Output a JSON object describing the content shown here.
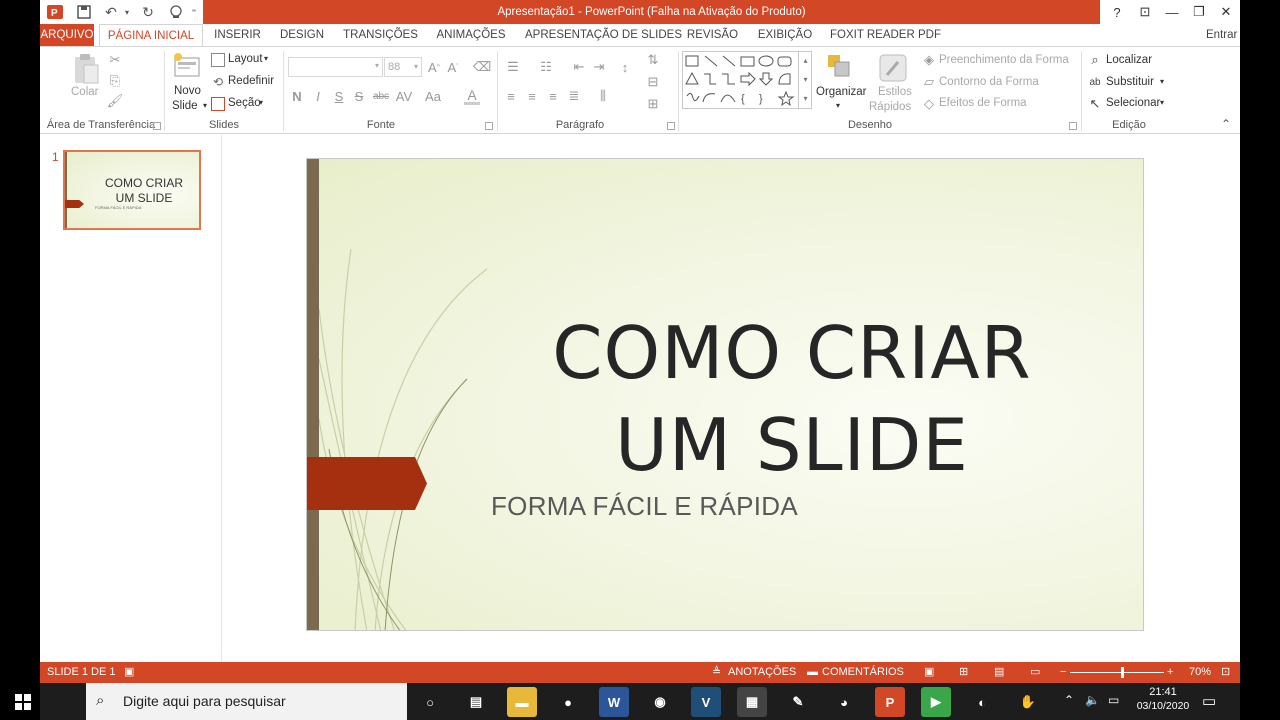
{
  "app": {
    "window_title": "Apresentação1 -  PowerPoint (Falha na Ativação do Produto)",
    "brand_color": "#d24726",
    "window_controls": {
      "help": "?",
      "ribbon_options": "⊡",
      "minimize": "—",
      "restore": "❐",
      "close": "✕"
    }
  },
  "quick_access": {
    "icons": [
      "powerpoint-logo-icon",
      "save-icon",
      "undo-icon",
      "redo-icon",
      "present-icon",
      "customize-icon"
    ]
  },
  "tabs": [
    {
      "label": "ARQUIVO",
      "key": "file"
    },
    {
      "label": "PÁGINA INICIAL",
      "key": "home",
      "active": true
    },
    {
      "label": "INSERIR",
      "key": "insert"
    },
    {
      "label": "DESIGN",
      "key": "design"
    },
    {
      "label": "TRANSIÇÕES",
      "key": "transitions"
    },
    {
      "label": "ANIMAÇÕES",
      "key": "animations"
    },
    {
      "label": "APRESENTAÇÃO DE SLIDES",
      "key": "slideshow"
    },
    {
      "label": "REVISÃO",
      "key": "review"
    },
    {
      "label": "EXIBIÇÃO",
      "key": "view"
    },
    {
      "label": "FOXIT READER PDF",
      "key": "foxit"
    }
  ],
  "signin": "Entrar",
  "ribbon": {
    "clipboard": {
      "label": "Área de Transferência",
      "paste": "Colar"
    },
    "slides": {
      "label": "Slides",
      "new_slide_1": "Novo",
      "new_slide_2": "Slide",
      "layout": "Layout",
      "reset": "Redefinir",
      "section": "Seção"
    },
    "font": {
      "label": "Fonte",
      "font_name": "",
      "font_size": "88",
      "buttons": [
        "N",
        "I",
        "S",
        "S",
        "abc",
        "AV",
        "Aa",
        "A"
      ]
    },
    "paragraph": {
      "label": "Parágrafo"
    },
    "drawing": {
      "label": "Desenho",
      "arrange": "Organizar",
      "quick_styles_1": "Estilos",
      "quick_styles_2": "Rápidos",
      "shape_fill": "Preenchimento da Forma",
      "shape_outline": "Contorno da Forma",
      "shape_effects": "Efeitos de Forma"
    },
    "editing": {
      "label": "Edição",
      "find": "Localizar",
      "replace": "Substituir",
      "select": "Selecionar"
    }
  },
  "thumbnails": [
    {
      "number": "1",
      "title_line1": "COMO CRIAR",
      "title_line2": "UM SLIDE",
      "subtitle": "FORMA FÁCIL E RÁPIDA"
    }
  ],
  "slide": {
    "title_line1": "COMO CRIAR",
    "title_line2": "UM SLIDE",
    "subtitle": "FORMA FÁCIL E RÁPIDA",
    "accent_color": "#a5300f",
    "bar_color": "#7a6a4f"
  },
  "statusbar": {
    "slide_counter": "SLIDE 1 DE 1",
    "notes": "ANOTAÇÕES",
    "comments": "COMENTÁRIOS",
    "zoom": "70%",
    "zoom_level": 0.55
  },
  "taskbar": {
    "search_placeholder": "Digite aqui para pesquisar",
    "apps": [
      {
        "name": "task-view-icon",
        "glyph": "○",
        "bg": ""
      },
      {
        "name": "timeline-icon",
        "glyph": "▤",
        "bg": ""
      },
      {
        "name": "file-explorer-icon",
        "glyph": "▬",
        "bg": "#e8b83a"
      },
      {
        "name": "chrome-canary-icon",
        "glyph": "●",
        "bg": ""
      },
      {
        "name": "word-icon",
        "glyph": "W",
        "bg": "#2b579a"
      },
      {
        "name": "chrome-icon",
        "glyph": "◉",
        "bg": ""
      },
      {
        "name": "vegas-icon",
        "glyph": "V",
        "bg": "#1f4e79"
      },
      {
        "name": "calculator-icon",
        "glyph": "▦",
        "bg": "#444"
      },
      {
        "name": "paint-icon",
        "glyph": "✎",
        "bg": ""
      },
      {
        "name": "firefox-icon",
        "glyph": "◕",
        "bg": ""
      },
      {
        "name": "powerpoint-icon",
        "glyph": "P",
        "bg": "#d24726"
      },
      {
        "name": "media-player-icon",
        "glyph": "▶",
        "bg": "#3aa64a"
      },
      {
        "name": "game-icon",
        "glyph": "◐",
        "bg": ""
      },
      {
        "name": "baseball-glove-icon",
        "glyph": "✋",
        "bg": ""
      }
    ],
    "time": "21:41",
    "date": "03/10/2020"
  }
}
